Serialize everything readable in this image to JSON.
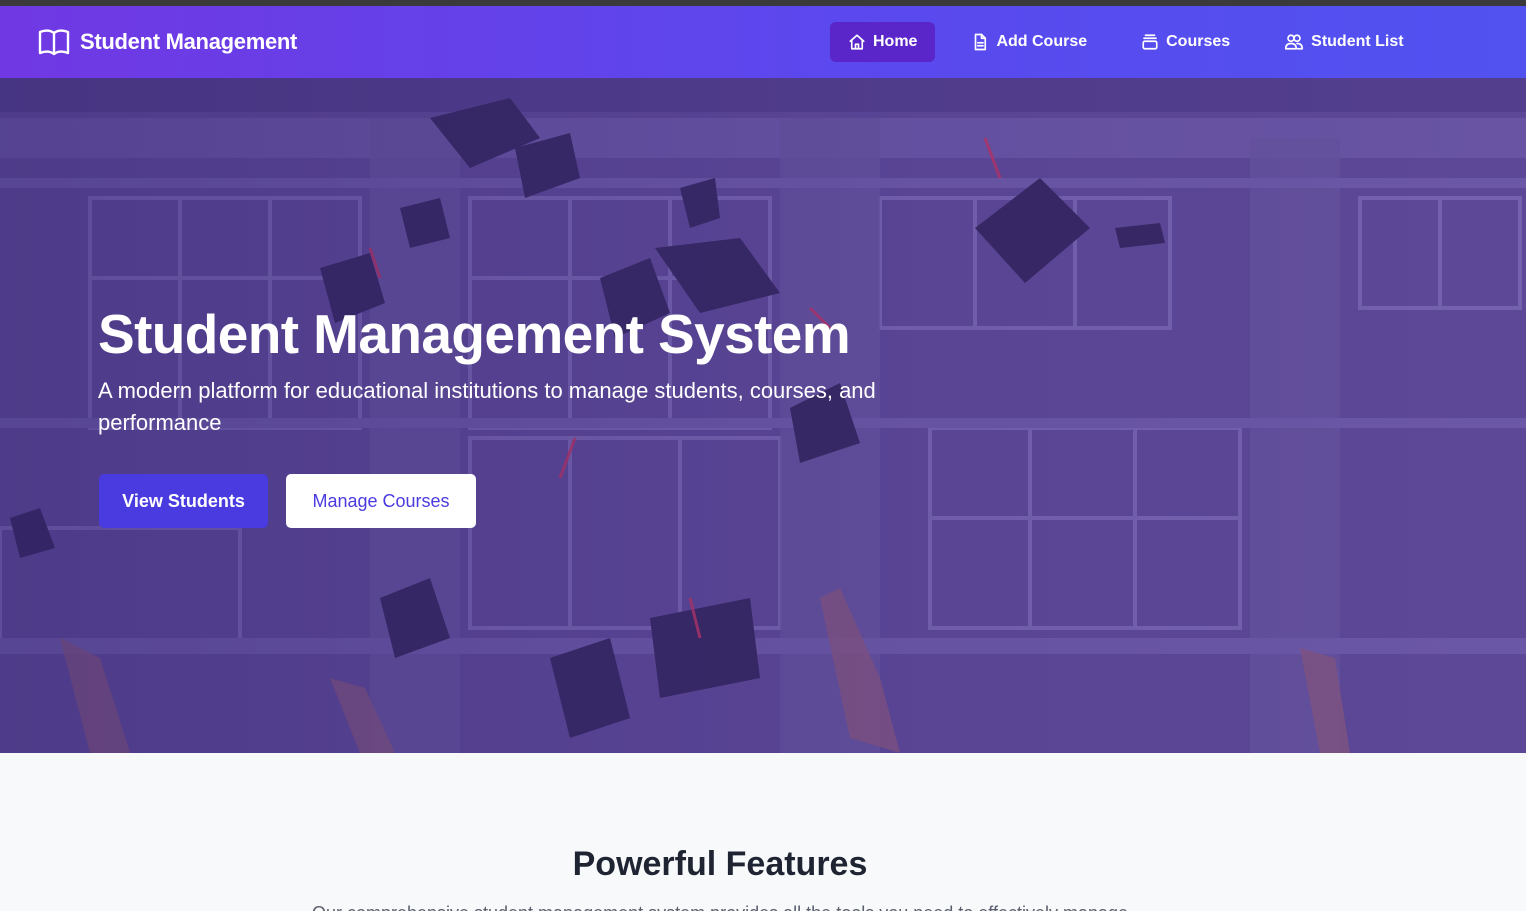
{
  "navbar": {
    "brand": "Student Management",
    "items": [
      {
        "label": "Home",
        "icon": "home-icon",
        "active": true
      },
      {
        "label": "Add Course",
        "icon": "document-icon",
        "active": false
      },
      {
        "label": "Courses",
        "icon": "inbox-icon",
        "active": false
      },
      {
        "label": "Student List",
        "icon": "users-icon",
        "active": false
      }
    ]
  },
  "hero": {
    "title": "Student Management System",
    "subtitle": "A modern platform for educational institutions to manage students, courses, and performance",
    "primary_button": "View Students",
    "secondary_button": "Manage Courses"
  },
  "features": {
    "title": "Powerful Features",
    "subtitle": "Our comprehensive student management system provides all the tools you need to effectively manage"
  },
  "colors": {
    "nav_start": "#7038e3",
    "nav_end": "#5152f0",
    "active_nav": "#5a25c9",
    "primary": "#4a3be0"
  }
}
